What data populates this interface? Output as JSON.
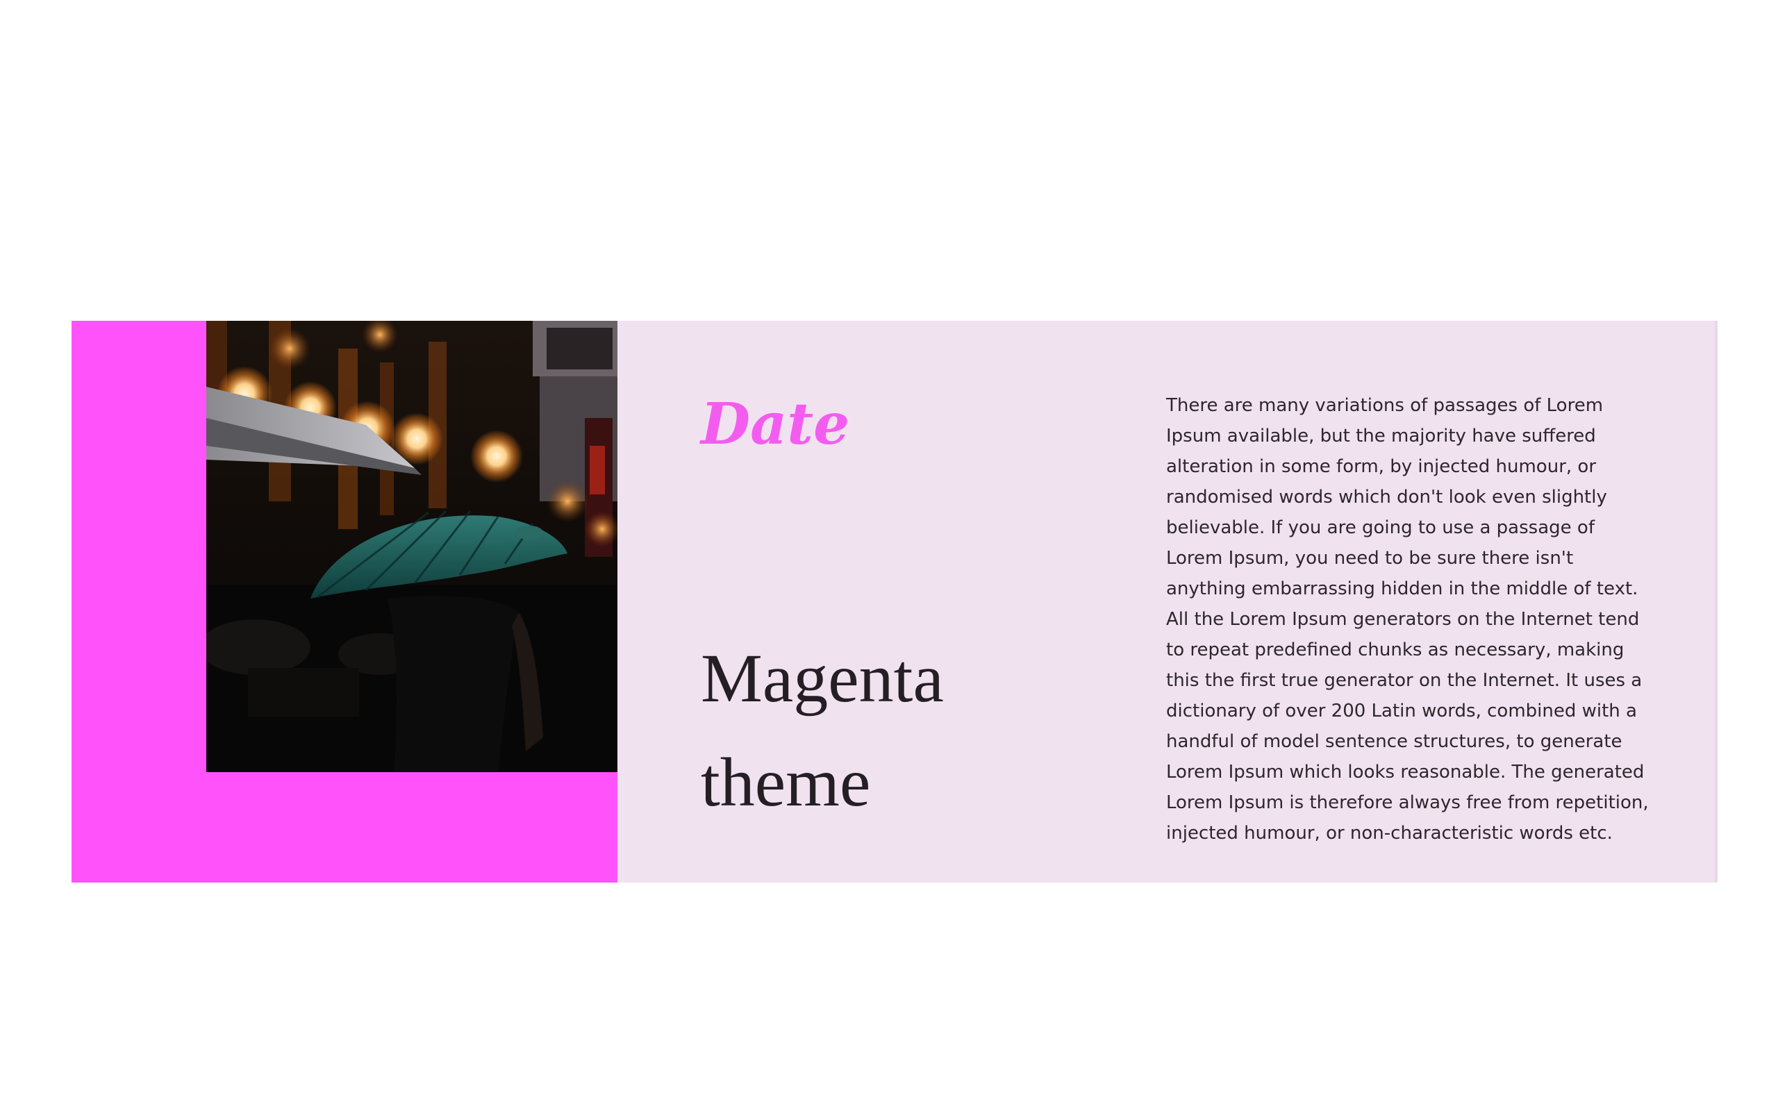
{
  "hero": {
    "date_label": "Date",
    "headline": "Magenta theme",
    "body": "There are many variations of passages of Lorem Ipsum available, but the majority have suffered alteration in some form, by injected humour, or randomised words which don't look even slightly believable. If you are going to use a passage of Lorem Ipsum, you need to be sure there isn't anything embarrassing hidden in the middle of text. All the Lorem Ipsum generators on the Internet tend to repeat predefined chunks as necessary, making this the first true generator on the Internet. It uses a dictionary of over 200 Latin words, combined with a handful of model sentence structures, to generate Lorem Ipsum which looks reasonable. The generated Lorem Ipsum is therefore always free from repetition, injected humour, or non-characteristic words etc."
  },
  "image": {
    "subject": "umbrella-in-night-street-photo"
  },
  "colors": {
    "accent": "#ff52fb",
    "panel_background": "#f1e2f0",
    "date_text": "#f25df0",
    "headline_text": "#241f24",
    "body_text": "#2d272d"
  }
}
